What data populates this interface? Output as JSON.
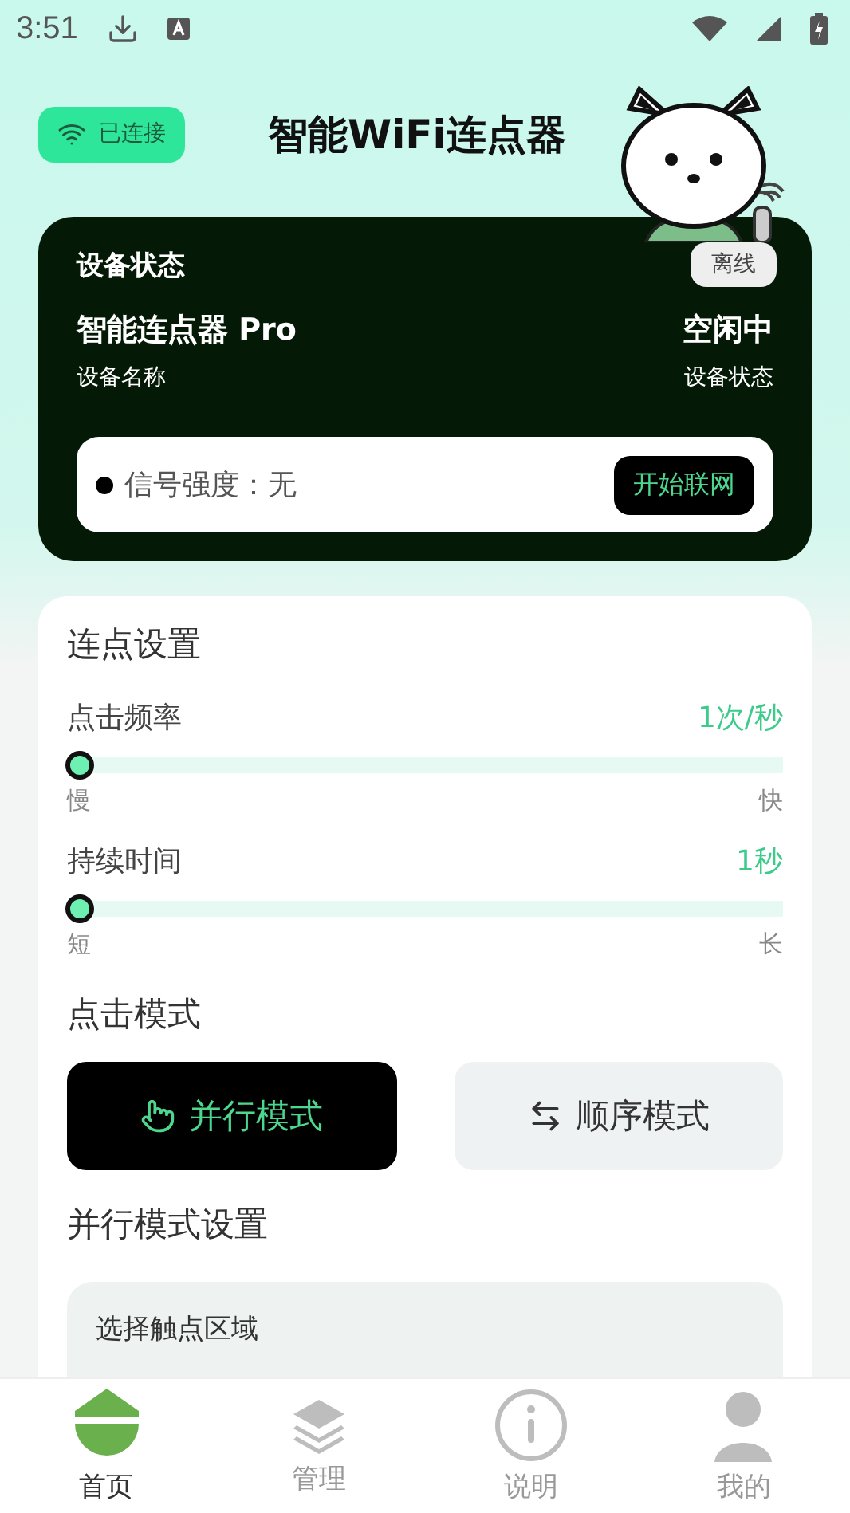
{
  "status_bar": {
    "time": "3:51"
  },
  "header": {
    "connection": {
      "label": "已连接",
      "connected": true
    },
    "title": "智能WiFi连点器"
  },
  "device_card": {
    "title": "设备状态",
    "badge": "离线",
    "name": "智能连点器 Pro",
    "name_label": "设备名称",
    "state": "空闲中",
    "state_label": "设备状态",
    "signal": "信号强度：无",
    "action": "开始联网"
  },
  "settings": {
    "title": "连点设置",
    "sliders": [
      {
        "label": "点击频率",
        "value": "1次/秒",
        "level": 0,
        "min_label": "慢",
        "max_label": "快"
      },
      {
        "label": "持续时间",
        "value": "1秒",
        "level": 0,
        "min_label": "短",
        "max_label": "长"
      }
    ],
    "mode_title": "点击模式",
    "modes": [
      {
        "label": "并行模式",
        "kind": "touch",
        "selected": true
      },
      {
        "label": "顺序模式",
        "kind": "swap",
        "selected": false
      }
    ],
    "parallel_title": "并行模式设置",
    "area_title": "选择触点区域"
  },
  "nav": [
    {
      "label": "首页",
      "kind": "home",
      "selected": true
    },
    {
      "label": "管理",
      "kind": "layers",
      "selected": false
    },
    {
      "label": "说明",
      "kind": "info",
      "selected": false
    },
    {
      "label": "我的",
      "kind": "user",
      "selected": false
    }
  ]
}
